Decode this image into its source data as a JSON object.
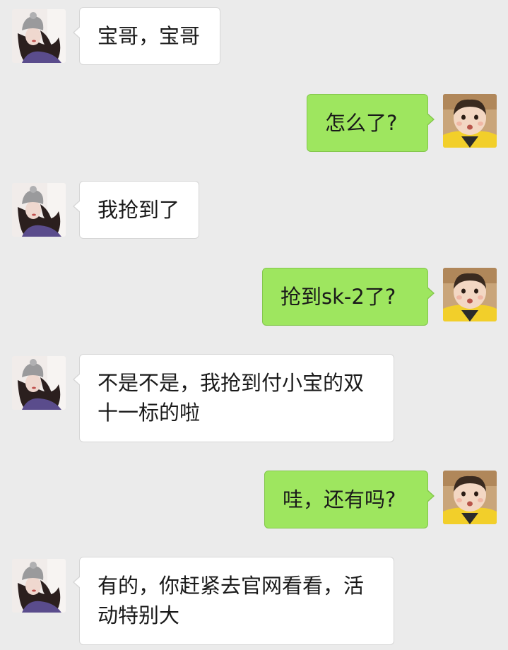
{
  "chat": {
    "messages": [
      {
        "sender": "girl",
        "text": "宝哥，宝哥"
      },
      {
        "sender": "baby",
        "text": "怎么了?"
      },
      {
        "sender": "girl",
        "text": "我抢到了"
      },
      {
        "sender": "baby",
        "text": "抢到sk-2了?"
      },
      {
        "sender": "girl",
        "lines": [
          "不是不是，我抢到付小宝的双",
          "十一标的啦"
        ]
      },
      {
        "sender": "baby",
        "text": "哇，还有吗?"
      },
      {
        "sender": "girl",
        "lines": [
          "有的，你赶紧去官网看看，活",
          "动特别大"
        ]
      }
    ]
  },
  "colors": {
    "background": "#ebebeb",
    "left_bubble": "#ffffff",
    "right_bubble": "#9ee65f"
  }
}
